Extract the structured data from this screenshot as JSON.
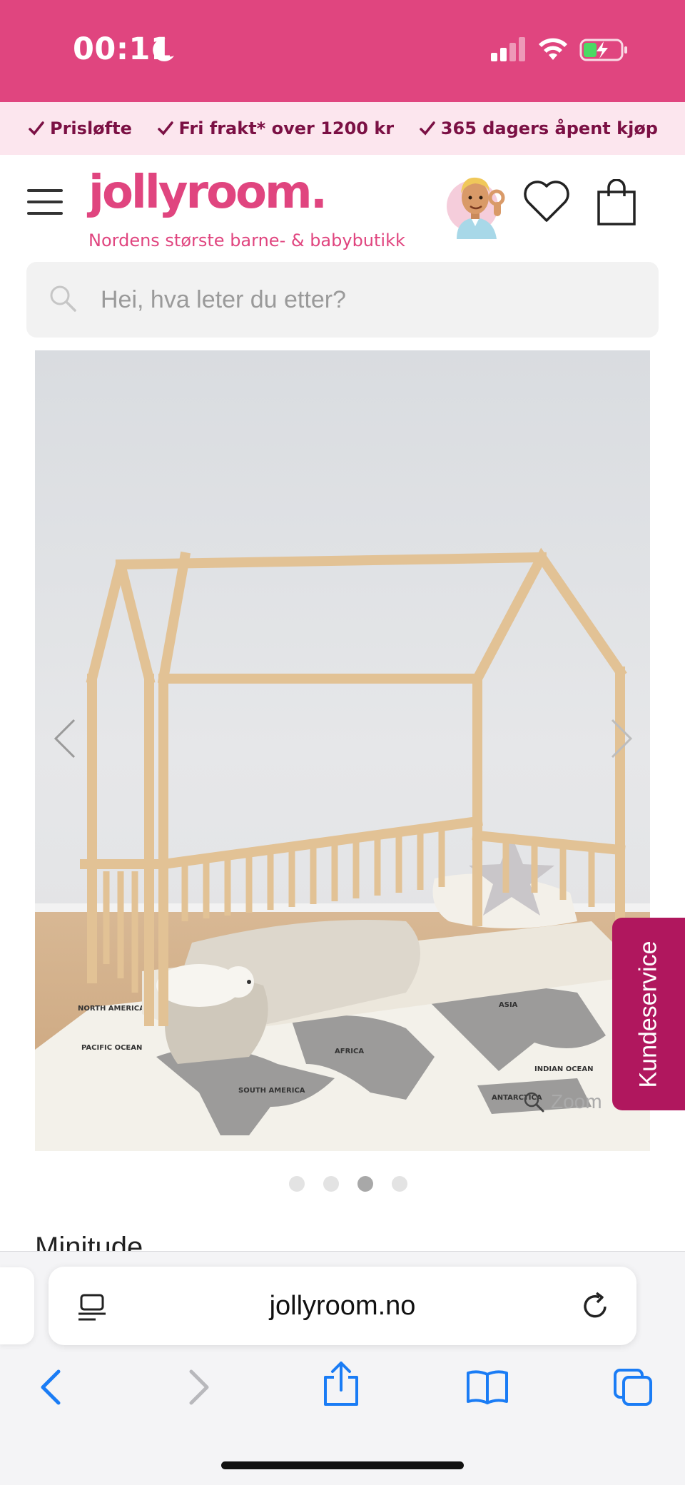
{
  "status_bar": {
    "time": "00:11",
    "moon_icon": "moon-icon",
    "signal_icon": "cellular-signal-icon",
    "wifi_icon": "wifi-icon",
    "battery_icon": "battery-charging-icon"
  },
  "promo": {
    "items": [
      {
        "label": "Prisløfte"
      },
      {
        "label": "Fri frakt* over 1200 kr"
      },
      {
        "label": "365 dagers åpent kjøp"
      }
    ]
  },
  "header": {
    "logo": "jollyroom.",
    "tagline": "Nordens største barne- & babybutikk"
  },
  "search": {
    "placeholder": "Hei, hva leter du etter?"
  },
  "gallery": {
    "zoom_label": "Zoom",
    "active_index": 2,
    "total_images": 4,
    "map_labels": [
      "NORTH AMERICA",
      "PACIFIC OCEAN",
      "ASIA",
      "AFRICA",
      "SOUTH AMERICA",
      "INDIAN OCEAN",
      "ANTARCTICA"
    ]
  },
  "kundeservice": {
    "label": "Kundeservice"
  },
  "product": {
    "brand": "Minitude"
  },
  "browser": {
    "url": "jollyroom.no"
  },
  "colors": {
    "brand_pink": "#e0457f",
    "promo_bg": "#fce6ee",
    "kundeservice_bg": "#b0175e",
    "ios_blue": "#1a7cf5"
  }
}
